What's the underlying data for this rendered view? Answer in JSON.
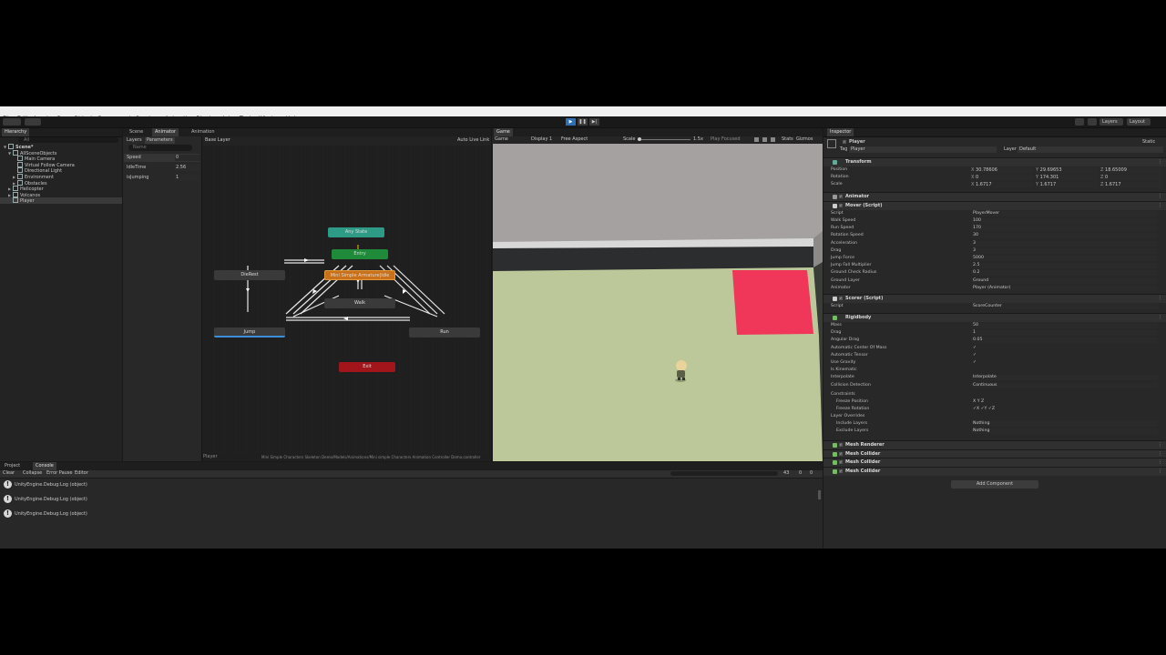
{
  "menu": [
    "File",
    "Edit",
    "Assets",
    "GameObject",
    "Component",
    "Services",
    "Animation Rigging",
    "Jobs",
    "Tools",
    "Window",
    "Help"
  ],
  "toolbar": {
    "layers": "Layers",
    "layout": "Layout"
  },
  "hierarchy": {
    "tab": "Hierarchy",
    "search_placeholder": "All",
    "rows": [
      {
        "label": "Scene*",
        "indent": 0,
        "bold": true,
        "open": true
      },
      {
        "label": "AllSceneObjects",
        "indent": 1,
        "open": true
      },
      {
        "label": "Main Camera",
        "indent": 2
      },
      {
        "label": "Virtual Follow Camera",
        "indent": 2
      },
      {
        "label": "Directional Light",
        "indent": 2
      },
      {
        "label": "Environment",
        "indent": 2,
        "open": false
      },
      {
        "label": "Obstacles",
        "indent": 2,
        "open": false
      },
      {
        "label": "Helicopter",
        "indent": 1,
        "open": false
      },
      {
        "label": "Volcanos",
        "indent": 1,
        "open": false
      },
      {
        "label": "Player",
        "indent": 1,
        "selected": true
      }
    ]
  },
  "animator": {
    "tabs": [
      "Scene",
      "Animator",
      "Animation"
    ],
    "sub_tabs": [
      "Layers",
      "Parameters"
    ],
    "base_layer": "Base Layer",
    "auto_live_link": "Auto Live Link",
    "search_placeholder": "Name",
    "parameters": [
      {
        "name": "Speed",
        "value": "0"
      },
      {
        "name": "IdleTime",
        "value": "2.56"
      },
      {
        "name": "isJumping",
        "value": "1"
      }
    ],
    "states": {
      "any": "Any State",
      "entry": "Entry",
      "idle": "Mini Simple Armature|Idle",
      "dies": "DieRest",
      "walk": "Walk",
      "jump": "Jump",
      "run": "Run",
      "exit": "Exit"
    },
    "footer_left": "Player",
    "footer_path": "Mini Simple Characters Skeleton Demo/Models/Animations/Mini simple Characters Animation Controller Demo.controller"
  },
  "game": {
    "tab": "Game",
    "display_mode": "Game",
    "display": "Display 1",
    "aspect": "Free Aspect",
    "scale_label": "Scale",
    "scale_value": "1.5x",
    "play_focused": "Play Focused",
    "stats": "Stats",
    "gizmos": "Gizmos"
  },
  "inspector": {
    "tab": "Inspector",
    "object_name": "Player",
    "static_label": "Static",
    "tag_label": "Tag",
    "tag_value": "Player",
    "layer_label": "Layer",
    "layer_value": "Default",
    "transform": {
      "title": "Transform",
      "rows": [
        {
          "label": "Position",
          "x": "30.78606",
          "y": "29.69653",
          "z": "18.65009"
        },
        {
          "label": "Rotation",
          "x": "0",
          "y": "174.301",
          "z": "0"
        },
        {
          "label": "Scale",
          "x": "1.6717",
          "y": "1.6717",
          "z": "1.6717"
        }
      ]
    },
    "animator_title": "Animator",
    "mover": {
      "title": "Mover (Script)",
      "script_label": "Script",
      "script_value": "PlayerMover",
      "fields": [
        {
          "label": "Walk Speed",
          "value": "100"
        },
        {
          "label": "Run Speed",
          "value": "170"
        },
        {
          "label": "Rotation Speed",
          "value": "30"
        },
        {
          "label": "Acceleration",
          "value": "3"
        },
        {
          "label": "Drag",
          "value": "3"
        },
        {
          "label": "Jump Force",
          "value": "5000"
        },
        {
          "label": "Jump Fall Multiplier",
          "value": "2.5"
        },
        {
          "label": "Ground Check Radius",
          "value": "0.2"
        },
        {
          "label": "Ground Layer",
          "value": "Ground"
        },
        {
          "label": "Animator",
          "value": "Player (Animator)"
        }
      ]
    },
    "scorer": {
      "title": "Scorer (Script)",
      "script_label": "Script",
      "script_value": "ScoreCounter"
    },
    "rigidbody": {
      "title": "Rigidbody",
      "fields": [
        {
          "label": "Mass",
          "value": "50"
        },
        {
          "label": "Drag",
          "value": "1"
        },
        {
          "label": "Angular Drag",
          "value": "0.05"
        },
        {
          "label": "Automatic Center Of Mass",
          "value": "✓"
        },
        {
          "label": "Automatic Tensor",
          "value": "✓"
        },
        {
          "label": "Use Gravity",
          "value": "✓"
        },
        {
          "label": "Is Kinematic",
          "value": ""
        },
        {
          "label": "Interpolate",
          "value": "Interpolate"
        },
        {
          "label": "Collision Detection",
          "value": "Continuous"
        }
      ],
      "constraints": "Constraints",
      "freeze_position": "Freeze Position",
      "freeze_position_value": "X  Y  Z",
      "freeze_rotation": "Freeze Rotation",
      "freeze_rotation_value": "✓X ✓Y ✓Z",
      "layer_overrides": "Layer Overrides",
      "include_layers": "Include Layers",
      "include_value": "Nothing",
      "exclude_layers": "Exclude Layers",
      "exclude_value": "Nothing"
    },
    "other_components": [
      "Mesh Renderer",
      "Mesh Collider",
      "Mesh Collider",
      "Mesh Collider"
    ],
    "add_component": "Add Component"
  },
  "console": {
    "tabs": [
      "Project",
      "Console"
    ],
    "toolbar": [
      "Clear",
      "Collapse",
      "Error Pause",
      "Editor"
    ],
    "count_warn": "43",
    "count_err": "0",
    "count_info": "0",
    "logs": [
      "UnityEngine.Debug:Log (object)",
      "UnityEngine.Debug:Log (object)",
      "UnityEngine.Debug:Log (object)"
    ]
  },
  "colors": {
    "idle": "#c8711a",
    "entry": "#1f8a3a",
    "any": "#2e9b86",
    "exit": "#a2151a",
    "pink": "#f0375a",
    "ground": "#bcc79a",
    "sky": "#9b9796"
  }
}
